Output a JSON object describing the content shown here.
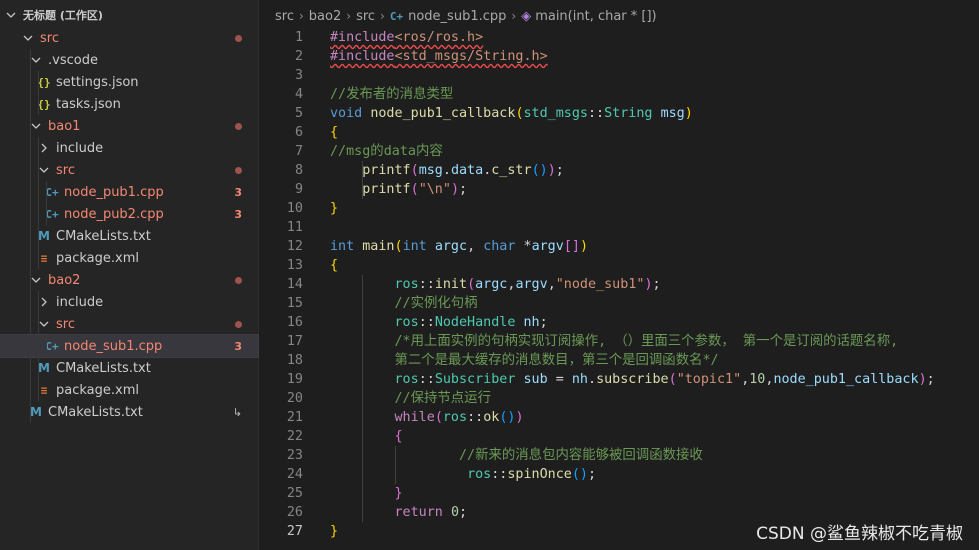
{
  "sidebar": {
    "workspace_title": "无标题 (工作区)",
    "items": [
      {
        "label": "src",
        "depth": 0,
        "kind": "folder",
        "open": true,
        "color": "err",
        "status": "dot"
      },
      {
        "label": ".vscode",
        "depth": 1,
        "kind": "folder",
        "open": true,
        "color": "normal",
        "status": ""
      },
      {
        "label": "settings.json",
        "depth": 2,
        "kind": "json",
        "color": "normal",
        "status": ""
      },
      {
        "label": "tasks.json",
        "depth": 2,
        "kind": "json",
        "color": "normal",
        "status": ""
      },
      {
        "label": "bao1",
        "depth": 1,
        "kind": "folder",
        "open": true,
        "color": "err",
        "status": "dot"
      },
      {
        "label": "include",
        "depth": 2,
        "kind": "folder",
        "open": false,
        "color": "normal",
        "status": ""
      },
      {
        "label": "src",
        "depth": 2,
        "kind": "folder",
        "open": true,
        "color": "err",
        "status": "dot"
      },
      {
        "label": "node_pub1.cpp",
        "depth": 3,
        "kind": "cpp",
        "color": "err",
        "status": "3"
      },
      {
        "label": "node_pub2.cpp",
        "depth": 3,
        "kind": "cpp",
        "color": "err",
        "status": "3"
      },
      {
        "label": "CMakeLists.txt",
        "depth": 2,
        "kind": "cmake",
        "color": "normal",
        "status": ""
      },
      {
        "label": "package.xml",
        "depth": 2,
        "kind": "xml",
        "color": "normal",
        "status": ""
      },
      {
        "label": "bao2",
        "depth": 1,
        "kind": "folder",
        "open": true,
        "color": "err",
        "status": "dot"
      },
      {
        "label": "include",
        "depth": 2,
        "kind": "folder",
        "open": false,
        "color": "normal",
        "status": ""
      },
      {
        "label": "src",
        "depth": 2,
        "kind": "folder",
        "open": true,
        "color": "err",
        "status": "dot"
      },
      {
        "label": "node_sub1.cpp",
        "depth": 3,
        "kind": "cpp",
        "color": "err",
        "status": "3",
        "selected": true
      },
      {
        "label": "CMakeLists.txt",
        "depth": 2,
        "kind": "cmake",
        "color": "normal",
        "status": ""
      },
      {
        "label": "package.xml",
        "depth": 2,
        "kind": "xml",
        "color": "normal",
        "status": ""
      },
      {
        "label": "CMakeLists.txt",
        "depth": 1,
        "kind": "cmake",
        "color": "normal",
        "status": "↳"
      }
    ]
  },
  "breadcrumb": {
    "parts": [
      "src",
      "bao2",
      "src",
      "node_sub1.cpp",
      "main(int, char * [])"
    ]
  },
  "editor": {
    "active_line": 27,
    "lines": [
      {
        "n": 1,
        "indent": 0,
        "tokens": [
          [
            "#include",
            "ctl sq"
          ],
          [
            "<ros/ros.h>",
            "str sq"
          ]
        ]
      },
      {
        "n": 2,
        "indent": 0,
        "tokens": [
          [
            "#include",
            "ctl sq"
          ],
          [
            "<std_msgs/String.h>",
            "str sq"
          ]
        ]
      },
      {
        "n": 3,
        "indent": 0,
        "tokens": []
      },
      {
        "n": 4,
        "indent": 0,
        "tokens": [
          [
            "//发布者的消息类型",
            "cm"
          ]
        ]
      },
      {
        "n": 5,
        "indent": 0,
        "tokens": [
          [
            "void",
            "kw"
          ],
          [
            " ",
            "p"
          ],
          [
            "node_pub1_callback",
            "fn"
          ],
          [
            "(",
            "br1"
          ],
          [
            "std_msgs",
            "ty"
          ],
          [
            "::",
            "p"
          ],
          [
            "String",
            "ty"
          ],
          [
            " ",
            "p"
          ],
          [
            "msg",
            "var"
          ],
          [
            ")",
            "br1"
          ]
        ]
      },
      {
        "n": 6,
        "indent": 0,
        "tokens": [
          [
            "{",
            "br1"
          ]
        ]
      },
      {
        "n": 7,
        "indent": 0,
        "tokens": [
          [
            "//msg的data内容",
            "cm"
          ]
        ]
      },
      {
        "n": 8,
        "indent": 1,
        "tokens": [
          [
            "    ",
            "p"
          ],
          [
            "printf",
            "fn"
          ],
          [
            "(",
            "br2"
          ],
          [
            "msg",
            "var"
          ],
          [
            ".",
            "p"
          ],
          [
            "data",
            "var"
          ],
          [
            ".",
            "p"
          ],
          [
            "c_str",
            "fn"
          ],
          [
            "()",
            "br3"
          ],
          [
            ")",
            "br2"
          ],
          [
            ";",
            "p"
          ]
        ]
      },
      {
        "n": 9,
        "indent": 1,
        "tokens": [
          [
            "    ",
            "p"
          ],
          [
            "printf",
            "fn"
          ],
          [
            "(",
            "br2"
          ],
          [
            "\"\\n\"",
            "str"
          ],
          [
            ")",
            "br2"
          ],
          [
            ";",
            "p"
          ]
        ]
      },
      {
        "n": 10,
        "indent": 0,
        "tokens": [
          [
            "}",
            "br1"
          ]
        ]
      },
      {
        "n": 11,
        "indent": 0,
        "tokens": []
      },
      {
        "n": 12,
        "indent": 0,
        "tokens": [
          [
            "int",
            "kw"
          ],
          [
            " ",
            "p"
          ],
          [
            "main",
            "fn"
          ],
          [
            "(",
            "br1"
          ],
          [
            "int",
            "kw"
          ],
          [
            " ",
            "p"
          ],
          [
            "argc",
            "var"
          ],
          [
            ", ",
            "p"
          ],
          [
            "char",
            "kw"
          ],
          [
            " *",
            "p"
          ],
          [
            "argv",
            "var"
          ],
          [
            "[]",
            "br2"
          ],
          [
            ")",
            "br1"
          ]
        ]
      },
      {
        "n": 13,
        "indent": 0,
        "tokens": [
          [
            "{",
            "br1"
          ]
        ]
      },
      {
        "n": 14,
        "indent": 1,
        "tokens": [
          [
            "        ",
            "p"
          ],
          [
            "ros",
            "ty"
          ],
          [
            "::",
            "p"
          ],
          [
            "init",
            "fn"
          ],
          [
            "(",
            "br2"
          ],
          [
            "argc",
            "var"
          ],
          [
            ",",
            "p"
          ],
          [
            "argv",
            "var"
          ],
          [
            ",",
            "p"
          ],
          [
            "\"node_sub1\"",
            "str"
          ],
          [
            ")",
            "br2"
          ],
          [
            ";",
            "p"
          ]
        ]
      },
      {
        "n": 15,
        "indent": 1,
        "tokens": [
          [
            "        ",
            "p"
          ],
          [
            "//实例化句柄",
            "cm"
          ]
        ]
      },
      {
        "n": 16,
        "indent": 1,
        "tokens": [
          [
            "        ",
            "p"
          ],
          [
            "ros",
            "ty"
          ],
          [
            "::",
            "p"
          ],
          [
            "NodeHandle",
            "ty"
          ],
          [
            " ",
            "p"
          ],
          [
            "nh",
            "var"
          ],
          [
            ";",
            "p"
          ]
        ]
      },
      {
        "n": 17,
        "indent": 1,
        "tokens": [
          [
            "        ",
            "p"
          ],
          [
            "/*用上面实例的句柄实现订阅操作, （）里面三个参数， 第一个是订阅的话题名称,",
            "cm"
          ]
        ]
      },
      {
        "n": 18,
        "indent": 1,
        "tokens": [
          [
            "        ",
            "p"
          ],
          [
            "第二个是最大缓存的消息数目，第三个是回调函数名*/",
            "cm"
          ]
        ]
      },
      {
        "n": 19,
        "indent": 1,
        "tokens": [
          [
            "        ",
            "p"
          ],
          [
            "ros",
            "ty"
          ],
          [
            "::",
            "p"
          ],
          [
            "Subscriber",
            "ty"
          ],
          [
            " ",
            "p"
          ],
          [
            "sub",
            "var"
          ],
          [
            " = ",
            "p"
          ],
          [
            "nh",
            "var"
          ],
          [
            ".",
            "p"
          ],
          [
            "subscribe",
            "fn"
          ],
          [
            "(",
            "br2"
          ],
          [
            "\"topic1\"",
            "str"
          ],
          [
            ",",
            "p"
          ],
          [
            "10",
            "num"
          ],
          [
            ",",
            "p"
          ],
          [
            "node_pub1_callback",
            "var"
          ],
          [
            ")",
            "br2"
          ],
          [
            ";",
            "p"
          ]
        ]
      },
      {
        "n": 20,
        "indent": 1,
        "tokens": [
          [
            "        ",
            "p"
          ],
          [
            "//保持节点运行",
            "cm"
          ]
        ]
      },
      {
        "n": 21,
        "indent": 1,
        "tokens": [
          [
            "        ",
            "p"
          ],
          [
            "while",
            "ctl"
          ],
          [
            "(",
            "br2"
          ],
          [
            "ros",
            "ty"
          ],
          [
            "::",
            "p"
          ],
          [
            "ok",
            "fn"
          ],
          [
            "()",
            "br3"
          ],
          [
            ")",
            "br2"
          ]
        ]
      },
      {
        "n": 22,
        "indent": 1,
        "tokens": [
          [
            "        ",
            "p"
          ],
          [
            "{",
            "br2"
          ]
        ]
      },
      {
        "n": 23,
        "indent": 2,
        "tokens": [
          [
            "                ",
            "p"
          ],
          [
            "//新来的消息包内容能够被回调函数接收",
            "cm"
          ]
        ]
      },
      {
        "n": 24,
        "indent": 2,
        "tokens": [
          [
            "                 ",
            "p"
          ],
          [
            "ros",
            "ty"
          ],
          [
            "::",
            "p"
          ],
          [
            "spinOnce",
            "fn"
          ],
          [
            "()",
            "br3"
          ],
          [
            ";",
            "p"
          ]
        ]
      },
      {
        "n": 25,
        "indent": 1,
        "tokens": [
          [
            "        ",
            "p"
          ],
          [
            "}",
            "br2"
          ]
        ]
      },
      {
        "n": 26,
        "indent": 1,
        "tokens": [
          [
            "        ",
            "p"
          ],
          [
            "return",
            "ctl"
          ],
          [
            " ",
            "p"
          ],
          [
            "0",
            "num"
          ],
          [
            ";",
            "p"
          ]
        ]
      },
      {
        "n": 27,
        "indent": 0,
        "tokens": [
          [
            "}",
            "br1"
          ]
        ]
      }
    ]
  },
  "watermark": "CSDN @鲨鱼辣椒不吃青椒",
  "colors": {
    "sidebar_bg": "#252526",
    "editor_bg": "#1e1e1e",
    "error": "#f48771",
    "selected_row": "#37373d"
  }
}
